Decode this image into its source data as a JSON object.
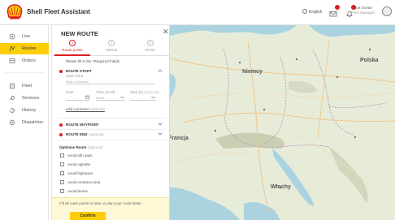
{
  "app": {
    "title": "Shell Fleet Assistant"
  },
  "header": {
    "language": "English",
    "user_name": "Sue Ocean",
    "user_sub": "Fleet Manager"
  },
  "sidebar": {
    "items": [
      {
        "label": "Live",
        "icon": "live-icon",
        "active": false
      },
      {
        "label": "Routes",
        "icon": "routes-icon",
        "active": true
      },
      {
        "label": "Orders",
        "icon": "orders-icon",
        "active": false
      },
      {
        "label": "Fleet",
        "icon": "fleet-icon",
        "active": false
      },
      {
        "label": "Services",
        "icon": "services-icon",
        "active": false
      },
      {
        "label": "History",
        "icon": "history-icon",
        "active": false
      },
      {
        "label": "Dispatcher",
        "icon": "dispatcher-icon",
        "active": false
      }
    ]
  },
  "panel": {
    "title": "NEW ROUTE",
    "steps": [
      {
        "number": "1",
        "label": "Route points"
      },
      {
        "number": "2",
        "label": "Vehicle"
      },
      {
        "number": "3",
        "label": "Driver"
      }
    ],
    "instruction": "Please fill in the *Required Fields",
    "route_start": {
      "title": "ROUTE START",
      "sub": "Start Point",
      "placeholder": "Enter a location",
      "date_label": "Date",
      "time_label": "Time (local)",
      "time_value": "14:00",
      "stop_label": "Stop (h)",
      "stop_optional": "(optional)",
      "add_comment": "Add comment",
      "add_comment_optional": "(optional)"
    },
    "route_waypoint": {
      "title": "ROUTE WAYPOINT"
    },
    "route_end": {
      "title": "ROUTE END",
      "optional": "(optional)"
    },
    "options": {
      "title": "Optimise Route",
      "optional": "(optional)",
      "items": [
        "Avoid toll roads",
        "Avoid vignette",
        "Avoid highways",
        "Avoid emission area",
        "Avoid ferries"
      ]
    },
    "footer_text": "Fill all route points to help us plan your route better",
    "confirm_label": "Confirm"
  },
  "map": {
    "labels": {
      "niemcy": "Niemcy",
      "francja": "Francja",
      "wlochy": "Włochy",
      "polska": "Polska"
    }
  },
  "colors": {
    "brand_yellow": "#fbce07",
    "brand_red": "#dd1d21",
    "water": "#aad3df",
    "land": "#e7ecd9"
  }
}
